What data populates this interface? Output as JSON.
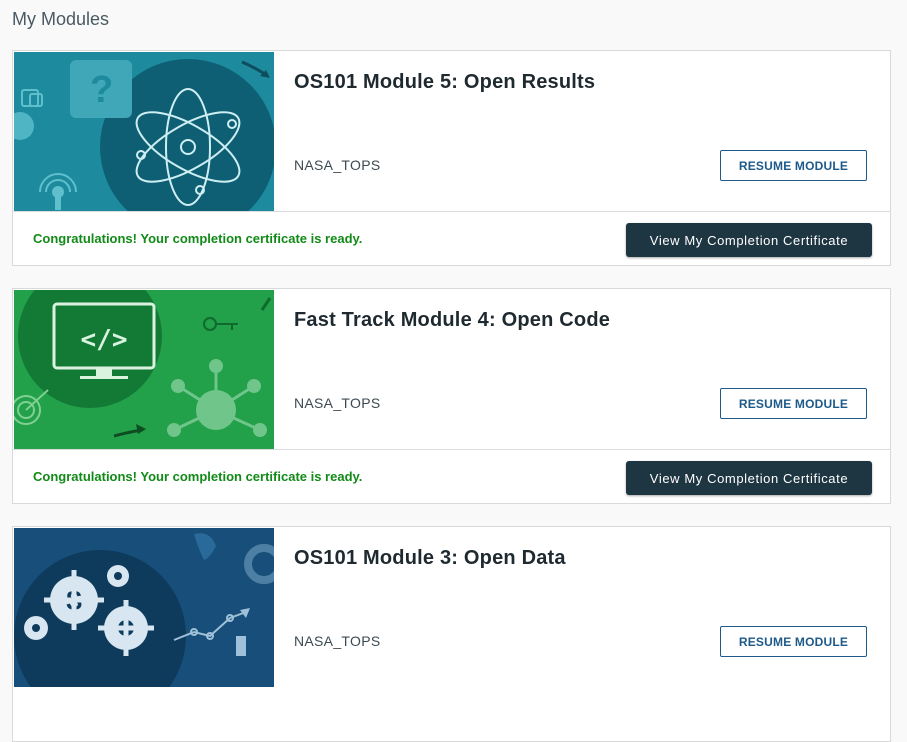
{
  "page": {
    "title": "My Modules"
  },
  "colors": {
    "accent": "#1d5a8a",
    "success": "#128a18",
    "dark_button": "#1e3542"
  },
  "modules": [
    {
      "title": "OS101 Module 5: Open Results",
      "org": "NASA_TOPS",
      "resume_label": "RESUME MODULE",
      "status_message": "Congratulations! Your completion certificate is ready.",
      "certificate_label": "View My Completion Certificate",
      "thumbnail_icon": "atom-icon",
      "thumbnail_color": "#1d8a9e"
    },
    {
      "title": "Fast Track Module 4: Open Code",
      "org": "NASA_TOPS",
      "resume_label": "RESUME MODULE",
      "status_message": "Congratulations! Your completion certificate is ready.",
      "certificate_label": "View My Completion Certificate",
      "thumbnail_icon": "code-monitor-icon",
      "thumbnail_color": "#23a04a"
    },
    {
      "title": "OS101 Module 3: Open Data",
      "org": "NASA_TOPS",
      "resume_label": "RESUME MODULE",
      "thumbnail_icon": "gears-icon",
      "thumbnail_color": "#174f7a"
    }
  ]
}
